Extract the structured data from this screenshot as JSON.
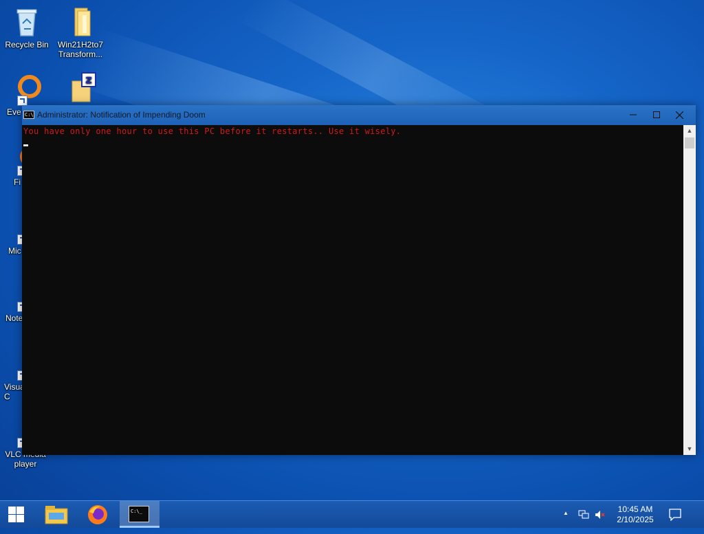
{
  "desktop": {
    "icons": [
      {
        "label": "Recycle Bin",
        "icon": "recycle-bin-icon"
      },
      {
        "label": "Win21H2to7 Transform...",
        "icon": "folder-icon"
      },
      {
        "label": "Eve",
        "icon": "everything-icon"
      },
      {
        "label": "",
        "icon": "archive-icon"
      },
      {
        "label": "Fi",
        "icon": "firefox-icon"
      },
      {
        "label": "Mic E",
        "icon": "edge-icon"
      },
      {
        "label": "Note",
        "icon": "notepad-icon"
      },
      {
        "label": "Visua C",
        "icon": "vscode-icon"
      },
      {
        "label": "VLC media player",
        "icon": "vlc-icon"
      }
    ]
  },
  "window": {
    "title": "Administrator:  Notification of Impending Doom",
    "icon": "console-icon",
    "minimize_label": "—",
    "maximize_label": "☐",
    "close_label": "✕",
    "console_text": "You have only one hour to use this PC before it restarts.. Use it wisely.",
    "text_color": "#d21a1a",
    "background_color": "#0c0c0c"
  },
  "taskbar": {
    "items": [
      {
        "name": "Start",
        "icon": "windows-start-icon"
      },
      {
        "name": "File Explorer",
        "icon": "file-explorer-icon"
      },
      {
        "name": "Firefox",
        "icon": "firefox-icon"
      },
      {
        "name": "Command Prompt",
        "icon": "cmd-icon",
        "active": true
      }
    ],
    "tray": {
      "chevron": "▲",
      "time": "10:45 AM",
      "date": "2/10/2025",
      "icons": [
        "network-icon",
        "volume-muted-icon",
        "action-center-icon"
      ]
    }
  }
}
